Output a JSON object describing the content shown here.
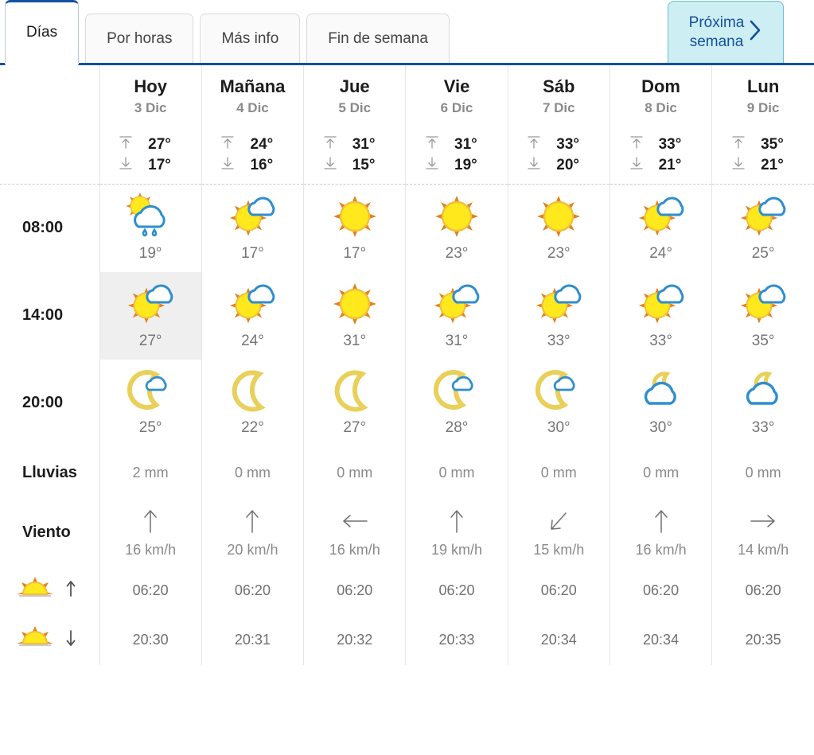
{
  "tabs": [
    {
      "label": "Días",
      "active": true
    },
    {
      "label": "Por horas",
      "active": false
    },
    {
      "label": "Más info",
      "active": false
    },
    {
      "label": "Fin de semana",
      "active": false
    }
  ],
  "next_week_button": {
    "line1": "Próxima",
    "line2": "semana",
    "icon": "chevron-right-icon"
  },
  "row_labels": {
    "hour_0800": "08:00",
    "hour_1400": "14:00",
    "hour_2000": "20:00",
    "rain": "Lluvias",
    "wind": "Viento",
    "sunrise": "sunrise-icon",
    "sunset": "sunset-icon"
  },
  "days": [
    {
      "name": "Hoy",
      "date": "3 Dic",
      "max": "27°",
      "min": "17°",
      "h08": {
        "icon": "sun-cloud-rain-icon",
        "temp": "19°"
      },
      "h14": {
        "icon": "sun-cloud-icon",
        "temp": "27°",
        "selected": true
      },
      "h20": {
        "icon": "moon-cloud-icon",
        "temp": "25°"
      },
      "rain": "2 mm",
      "wind_dir": "up",
      "wind": "16 km/h",
      "sunrise": "06:20",
      "sunset": "20:30"
    },
    {
      "name": "Mañana",
      "date": "4 Dic",
      "max": "24°",
      "min": "16°",
      "h08": {
        "icon": "sun-cloud-icon",
        "temp": "17°"
      },
      "h14": {
        "icon": "sun-cloud-icon",
        "temp": "24°",
        "selected": false
      },
      "h20": {
        "icon": "moon-icon",
        "temp": "22°"
      },
      "rain": "0 mm",
      "wind_dir": "up",
      "wind": "20 km/h",
      "sunrise": "06:20",
      "sunset": "20:31"
    },
    {
      "name": "Jue",
      "date": "5 Dic",
      "max": "31°",
      "min": "15°",
      "h08": {
        "icon": "sun-icon",
        "temp": "17°"
      },
      "h14": {
        "icon": "sun-icon",
        "temp": "31°",
        "selected": false
      },
      "h20": {
        "icon": "moon-icon",
        "temp": "27°"
      },
      "rain": "0 mm",
      "wind_dir": "left",
      "wind": "16 km/h",
      "sunrise": "06:20",
      "sunset": "20:32"
    },
    {
      "name": "Vie",
      "date": "6 Dic",
      "max": "31°",
      "min": "19°",
      "h08": {
        "icon": "sun-icon",
        "temp": "23°"
      },
      "h14": {
        "icon": "sun-cloud-icon",
        "temp": "31°",
        "selected": false
      },
      "h20": {
        "icon": "moon-cloud-icon",
        "temp": "28°"
      },
      "rain": "0 mm",
      "wind_dir": "up",
      "wind": "19 km/h",
      "sunrise": "06:20",
      "sunset": "20:33"
    },
    {
      "name": "Sáb",
      "date": "7 Dic",
      "max": "33°",
      "min": "20°",
      "h08": {
        "icon": "sun-icon",
        "temp": "23°"
      },
      "h14": {
        "icon": "sun-cloud-icon",
        "temp": "33°",
        "selected": false
      },
      "h20": {
        "icon": "moon-cloud-icon",
        "temp": "30°"
      },
      "rain": "0 mm",
      "wind_dir": "downleft",
      "wind": "15 km/h",
      "sunrise": "06:20",
      "sunset": "20:34"
    },
    {
      "name": "Dom",
      "date": "8 Dic",
      "max": "33°",
      "min": "21°",
      "h08": {
        "icon": "sun-cloud-icon",
        "temp": "24°"
      },
      "h14": {
        "icon": "sun-cloud-icon",
        "temp": "33°",
        "selected": false
      },
      "h20": {
        "icon": "cloud-moon-icon",
        "temp": "30°"
      },
      "rain": "0 mm",
      "wind_dir": "up",
      "wind": "16 km/h",
      "sunrise": "06:20",
      "sunset": "20:34"
    },
    {
      "name": "Lun",
      "date": "9 Dic",
      "max": "35°",
      "min": "21°",
      "h08": {
        "icon": "sun-cloud-icon",
        "temp": "25°"
      },
      "h14": {
        "icon": "sun-cloud-icon",
        "temp": "35°",
        "selected": false
      },
      "h20": {
        "icon": "cloud-moon-icon",
        "temp": "33°"
      },
      "rain": "0 mm",
      "wind_dir": "right",
      "wind": "14 km/h",
      "sunrise": "06:20",
      "sunset": "20:35"
    }
  ],
  "colors": {
    "accent_blue": "#14509f",
    "sun_yellow": "#ffe81c",
    "sun_orange": "#e2801e",
    "cloud_blue": "#2e8ece",
    "moon_yellow": "#e8d05a",
    "selected_cell": "#efefef"
  }
}
